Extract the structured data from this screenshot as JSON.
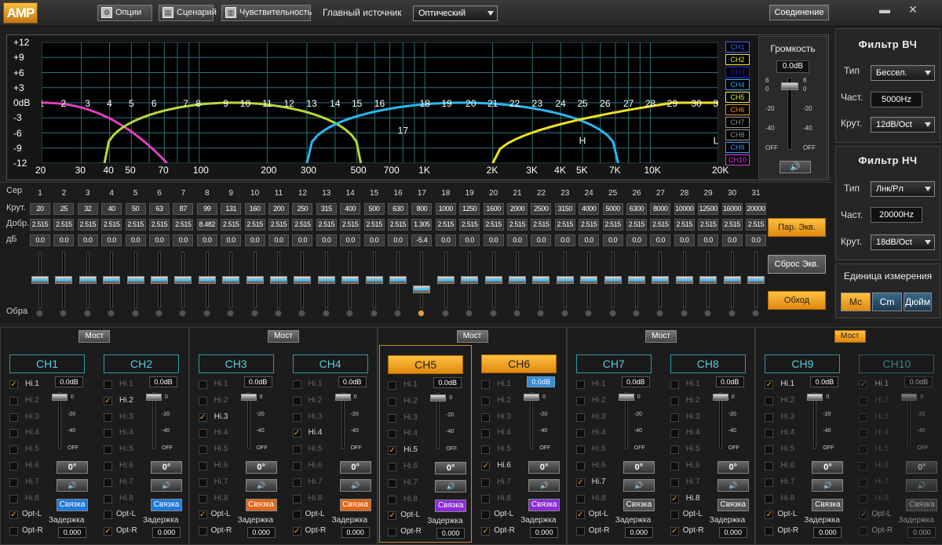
{
  "logo": "AMP",
  "toolbar": {
    "options": "Опции",
    "scenarios": "Сценарий",
    "sensitivity": "Чувствительность",
    "source_label": "Главный источник",
    "source_value": "Оптический",
    "connect": "Соединение",
    "minimize": "▬",
    "close": "✕"
  },
  "graph": {
    "y_ticks": [
      "+12",
      "+9",
      "+6",
      "+3",
      "0dB",
      "-3",
      "-6",
      "-9",
      "-12"
    ],
    "x_ticks": [
      {
        "label": "20",
        "f": 20
      },
      {
        "label": "30",
        "f": 30
      },
      {
        "label": "40",
        "f": 40
      },
      {
        "label": "50",
        "f": 50
      },
      {
        "label": "70",
        "f": 70
      },
      {
        "label": "100",
        "f": 100
      },
      {
        "label": "200",
        "f": 200
      },
      {
        "label": "300",
        "f": 300
      },
      {
        "label": "500",
        "f": 500
      },
      {
        "label": "700",
        "f": 700
      },
      {
        "label": "1K",
        "f": 1000
      },
      {
        "label": "2K",
        "f": 2000
      },
      {
        "label": "3K",
        "f": 3000
      },
      {
        "label": "4K",
        "f": 4000
      },
      {
        "label": "5K",
        "f": 5000
      },
      {
        "label": "7K",
        "f": 7000
      },
      {
        "label": "10K",
        "f": 10000
      },
      {
        "label": "20K",
        "f": 20000
      }
    ],
    "marker_H": "H",
    "marker_L": "L",
    "channel_legend": [
      {
        "label": "CH1",
        "color": "#3a6cff"
      },
      {
        "label": "CH2",
        "color": "#e6e630"
      },
      {
        "label": "CH3",
        "color": "#2020e0"
      },
      {
        "label": "CH4",
        "color": "#30a8ff"
      },
      {
        "label": "CH5",
        "color": "#f0f040"
      },
      {
        "label": "CH6",
        "color": "#f09020"
      },
      {
        "label": "CH7",
        "color": "#909090"
      },
      {
        "label": "CH8",
        "color": "#909090"
      },
      {
        "label": "CH9",
        "color": "#3a9aff"
      },
      {
        "label": "CH10",
        "color": "#e040e0"
      }
    ]
  },
  "volume": {
    "title": "Громкость",
    "value": "0.0dB",
    "scale": [
      "6",
      "0",
      "-20",
      "-40",
      "OFF"
    ],
    "mute_icon": "speaker-icon"
  },
  "hpf": {
    "title": "Фильтр ВЧ",
    "type_label": "Тип",
    "type_value": "Бессел.",
    "freq_label": "Част.",
    "freq_value": "5000Hz",
    "slope_label": "Крут.",
    "slope_value": "12dB/Oct"
  },
  "lpf": {
    "title": "Фильтр НЧ",
    "type_label": "Тип",
    "type_value": "Лнк/Рл",
    "freq_label": "Част.",
    "freq_value": "20000Hz",
    "slope_label": "Крут.",
    "slope_value": "18dB/Oct"
  },
  "units": {
    "title": "Единица измерения",
    "options": [
      "Мс",
      "Cm",
      "Дюйм"
    ],
    "selected": "Мс"
  },
  "eq": {
    "row_labels": {
      "band": "Сер",
      "freq": "Крут.",
      "q": "Добр.",
      "gain": "дБ",
      "reverse": "Обра"
    },
    "bands": [
      {
        "n": "1",
        "f": "20",
        "q": "2.515",
        "g": "0.0"
      },
      {
        "n": "2",
        "f": "25",
        "q": "2.515",
        "g": "0.0"
      },
      {
        "n": "3",
        "f": "32",
        "q": "2.515",
        "g": "0.0"
      },
      {
        "n": "4",
        "f": "40",
        "q": "2.515",
        "g": "0.0"
      },
      {
        "n": "5",
        "f": "50",
        "q": "2.515",
        "g": "0.0"
      },
      {
        "n": "6",
        "f": "63",
        "q": "2.515",
        "g": "0.0"
      },
      {
        "n": "7",
        "f": "87",
        "q": "2.515",
        "g": "0.0"
      },
      {
        "n": "8",
        "f": "99",
        "q": "8.482",
        "g": "0.0"
      },
      {
        "n": "9",
        "f": "131",
        "q": "2.515",
        "g": "0.0"
      },
      {
        "n": "10",
        "f": "160",
        "q": "2.515",
        "g": "0.0"
      },
      {
        "n": "11",
        "f": "200",
        "q": "2.515",
        "g": "0.0"
      },
      {
        "n": "12",
        "f": "250",
        "q": "2.515",
        "g": "0.0"
      },
      {
        "n": "13",
        "f": "315",
        "q": "2.515",
        "g": "0.0"
      },
      {
        "n": "14",
        "f": "400",
        "q": "2.515",
        "g": "0.0"
      },
      {
        "n": "15",
        "f": "500",
        "q": "2.515",
        "g": "0.0"
      },
      {
        "n": "16",
        "f": "630",
        "q": "2.515",
        "g": "0.0"
      },
      {
        "n": "17",
        "f": "800",
        "q": "1.305",
        "g": "-5.4"
      },
      {
        "n": "18",
        "f": "1000",
        "q": "2.515",
        "g": "0.0"
      },
      {
        "n": "19",
        "f": "1250",
        "q": "2.515",
        "g": "0.0"
      },
      {
        "n": "20",
        "f": "1600",
        "q": "2.515",
        "g": "0.0"
      },
      {
        "n": "21",
        "f": "2000",
        "q": "2.515",
        "g": "0.0"
      },
      {
        "n": "22",
        "f": "2500",
        "q": "2.515",
        "g": "0.0"
      },
      {
        "n": "23",
        "f": "3150",
        "q": "2.515",
        "g": "0.0"
      },
      {
        "n": "24",
        "f": "4000",
        "q": "2.515",
        "g": "0.0"
      },
      {
        "n": "25",
        "f": "5000",
        "q": "2.515",
        "g": "0.0"
      },
      {
        "n": "26",
        "f": "6300",
        "q": "2.515",
        "g": "0.0"
      },
      {
        "n": "27",
        "f": "8000",
        "q": "2.515",
        "g": "0.0"
      },
      {
        "n": "28",
        "f": "10000",
        "q": "2.515",
        "g": "0.0"
      },
      {
        "n": "29",
        "f": "12500",
        "q": "2.515",
        "g": "0.0"
      },
      {
        "n": "30",
        "f": "16000",
        "q": "2.515",
        "g": "0.0"
      },
      {
        "n": "31",
        "f": "20000",
        "q": "2.515",
        "g": "0.0"
      }
    ],
    "active_band_index": 16,
    "param_eq_button": "Пар. Экв.",
    "reset_button": "Сброс Экв.",
    "bypass_button": "Обход"
  },
  "bridge_label": "Мост",
  "bridge_states": [
    false,
    false,
    false,
    false,
    true
  ],
  "channel_common": {
    "hi_labels": [
      "Hi.1",
      "Hi.2",
      "Hi.3",
      "Hi.4",
      "Hi.5",
      "Hi.6",
      "Hi.7",
      "Hi.8"
    ],
    "opt_l": "Opt-L",
    "opt_r": "Opt-R",
    "gain_value": "0.0dB",
    "scale": [
      "0",
      "-20",
      "-40",
      "OFF"
    ],
    "phase": "0°",
    "link_label": "Связка",
    "delay_label": "Задержка",
    "delay_value": "0.000"
  },
  "channels": [
    {
      "name": "CH1",
      "checked_hi": 0,
      "opt_l": true,
      "opt_r": false,
      "link_color": "#1e7adc",
      "selected": false,
      "disabled": false
    },
    {
      "name": "CH2",
      "checked_hi": 1,
      "opt_l": false,
      "opt_r": true,
      "link_color": "#1e7adc",
      "selected": false,
      "disabled": false
    },
    {
      "name": "CH3",
      "checked_hi": 2,
      "opt_l": true,
      "opt_r": false,
      "link_color": "#e06818",
      "selected": false,
      "disabled": false
    },
    {
      "name": "CH4",
      "checked_hi": 3,
      "opt_l": false,
      "opt_r": true,
      "link_color": "#e06818",
      "selected": false,
      "disabled": false
    },
    {
      "name": "CH5",
      "checked_hi": 4,
      "opt_l": true,
      "opt_r": false,
      "link_color": "#8a2ad8",
      "selected": true,
      "disabled": false
    },
    {
      "name": "CH6",
      "checked_hi": 5,
      "opt_l": false,
      "opt_r": true,
      "link_color": "#8a2ad8",
      "selected": true,
      "disabled": false,
      "gain_highlight": true
    },
    {
      "name": "CH7",
      "checked_hi": 6,
      "opt_l": true,
      "opt_r": false,
      "link_color": "#505050",
      "selected": false,
      "disabled": false
    },
    {
      "name": "CH8",
      "checked_hi": 7,
      "opt_l": false,
      "opt_r": true,
      "link_color": "#505050",
      "selected": false,
      "disabled": false
    },
    {
      "name": "CH9",
      "checked_hi": 0,
      "opt_l": true,
      "opt_r": false,
      "link_color": "#505050",
      "selected": false,
      "disabled": false
    },
    {
      "name": "CH10",
      "checked_hi": 0,
      "opt_l": true,
      "opt_r": false,
      "link_color": "#505050",
      "selected": false,
      "disabled": true
    }
  ]
}
